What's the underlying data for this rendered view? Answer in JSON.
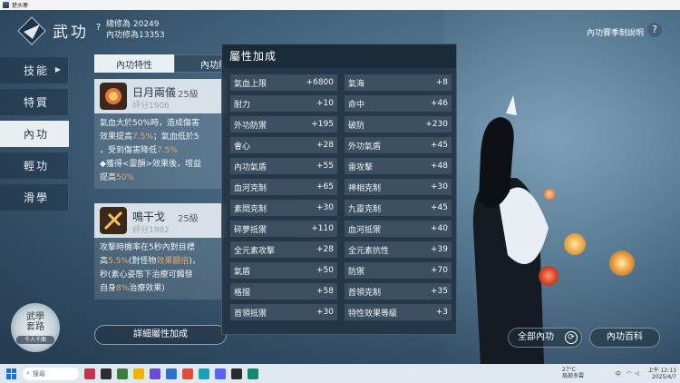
{
  "window": {
    "title": "楚水寨"
  },
  "header": {
    "title": "武功",
    "help_glyph": "?",
    "stat_total": "總修為 20249",
    "stat_inner": "內功修為13353",
    "season_link": "內功賽季制說明",
    "season_help_glyph": "?"
  },
  "nav": {
    "items": [
      {
        "label": "技能",
        "has_arrow": true
      },
      {
        "label": "特質"
      },
      {
        "label": "內功",
        "active": true
      },
      {
        "label": "輕功"
      },
      {
        "label": "滑學"
      }
    ],
    "arrow_glyph": "▶"
  },
  "tabs": [
    {
      "label": "內功特性",
      "active": true
    },
    {
      "label": "內功屬"
    }
  ],
  "skills": [
    {
      "name": "日月兩儀",
      "level": "25級",
      "score": "評分1906",
      "desc": [
        "氣血大於50%時，造成傷害",
        "效果提高",
        "7.5%",
        "；氣血低於5",
        "，受到傷害降低",
        "7.5%",
        "◆獲得<靈韻>效果後，增益",
        "提高",
        "50%"
      ]
    },
    {
      "name": "鳴干戈",
      "level": "25級",
      "score": "評分1982",
      "desc": [
        "攻擊時機率在5秒內對目標",
        "高",
        "5.5%",
        "(對怪物",
        "效果翻倍",
        ")，",
        "秒(素心姿態下治療可觸發",
        "自身",
        "8%",
        "治療效果)"
      ]
    }
  ],
  "detail_button": "詳細屬性加成",
  "route_badge": {
    "line1": "武學",
    "line2": "套路",
    "sub": "千人千面"
  },
  "attr_panel": {
    "title": "屬性加成",
    "rows": [
      {
        "name": "氣血上限",
        "value": "+6800"
      },
      {
        "name": "氣海",
        "value": "+8"
      },
      {
        "name": "耐力",
        "value": "+10"
      },
      {
        "name": "命中",
        "value": "+46"
      },
      {
        "name": "外功防禦",
        "value": "+195"
      },
      {
        "name": "破防",
        "value": "+230"
      },
      {
        "name": "會心",
        "value": "+28"
      },
      {
        "name": "外功氣盾",
        "value": "+45"
      },
      {
        "name": "內功氣盾",
        "value": "+55"
      },
      {
        "name": "雷攻擊",
        "value": "+48"
      },
      {
        "name": "血河克制",
        "value": "+65"
      },
      {
        "name": "神相克制",
        "value": "+30"
      },
      {
        "name": "素問克制",
        "value": "+30"
      },
      {
        "name": "九靈克制",
        "value": "+45"
      },
      {
        "name": "碎夢抵禦",
        "value": "+110"
      },
      {
        "name": "血河抵禦",
        "value": "+40"
      },
      {
        "name": "全元素攻擊",
        "value": "+28"
      },
      {
        "name": "全元素抗性",
        "value": "+39"
      },
      {
        "name": "氣盾",
        "value": "+50"
      },
      {
        "name": "防禦",
        "value": "+70"
      },
      {
        "name": "格擋",
        "value": "+58"
      },
      {
        "name": "首領克制",
        "value": "+35"
      },
      {
        "name": "首領抵禦",
        "value": "+30"
      },
      {
        "name": "特性效果等級",
        "value": "+3"
      }
    ]
  },
  "right": {
    "all_inner": "全部內功",
    "refresh_glyph": "⟳",
    "wiki": "內功百科"
  },
  "taskbar": {
    "search_placeholder": "搜尋",
    "weather_temp": "27°C",
    "weather_desc": "局部多雲",
    "tray_lang": "中",
    "time": "上午 12:13",
    "date": "2025/4/7"
  }
}
